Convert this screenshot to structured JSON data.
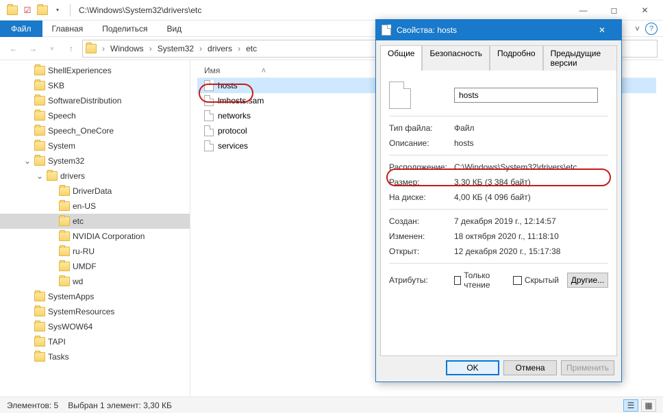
{
  "titlebar": {
    "path": "C:\\Windows\\System32\\drivers\\etc"
  },
  "ribbon": {
    "file": "Файл",
    "tabs": [
      "Главная",
      "Поделиться",
      "Вид"
    ]
  },
  "breadcrumb": [
    "Windows",
    "System32",
    "drivers",
    "etc"
  ],
  "tree": [
    {
      "label": "ShellExperiences",
      "depth": 1
    },
    {
      "label": "SKB",
      "depth": 1
    },
    {
      "label": "SoftwareDistribution",
      "depth": 1
    },
    {
      "label": "Speech",
      "depth": 1
    },
    {
      "label": "Speech_OneCore",
      "depth": 1
    },
    {
      "label": "System",
      "depth": 1
    },
    {
      "label": "System32",
      "depth": 1,
      "expanded": true
    },
    {
      "label": "drivers",
      "depth": 2,
      "expanded": true
    },
    {
      "label": "DriverData",
      "depth": 3
    },
    {
      "label": "en-US",
      "depth": 3
    },
    {
      "label": "etc",
      "depth": 3,
      "selected": true
    },
    {
      "label": "NVIDIA Corporation",
      "depth": 3
    },
    {
      "label": "ru-RU",
      "depth": 3
    },
    {
      "label": "UMDF",
      "depth": 3
    },
    {
      "label": "wd",
      "depth": 3
    },
    {
      "label": "SystemApps",
      "depth": 1
    },
    {
      "label": "SystemResources",
      "depth": 1
    },
    {
      "label": "SysWOW64",
      "depth": 1
    },
    {
      "label": "TAPI",
      "depth": 1
    },
    {
      "label": "Tasks",
      "depth": 1
    }
  ],
  "list": {
    "header_name": "Имя",
    "sort_indicator": "˄",
    "items": [
      "hosts",
      "lmhosts.sam",
      "networks",
      "protocol",
      "services"
    ],
    "selected": "hosts"
  },
  "status": {
    "count": "Элементов: 5",
    "selection": "Выбран 1 элемент: 3,30 КБ"
  },
  "dlg": {
    "title": "Свойства: hosts",
    "tabs": [
      "Общие",
      "Безопасность",
      "Подробно",
      "Предыдущие версии"
    ],
    "filename": "hosts",
    "rows": {
      "type_label": "Тип файла:",
      "type_val": "Файл",
      "desc_label": "Описание:",
      "desc_val": "hosts",
      "loc_label": "Расположение:",
      "loc_val": "C:\\Windows\\System32\\drivers\\etc",
      "size_label": "Размер:",
      "size_val": "3,30 КБ (3 384 байт)",
      "disk_label": "На диске:",
      "disk_val": "4,00 КБ (4 096 байт)",
      "created_label": "Создан:",
      "created_val": "7 декабря 2019 г., 12:14:57",
      "modified_label": "Изменен:",
      "modified_val": "18 октября 2020 г., 11:18:10",
      "opened_label": "Открыт:",
      "opened_val": "12 декабря 2020 г., 15:17:38",
      "attr_label": "Атрибуты:",
      "readonly": "Только чтение",
      "hidden": "Скрытый",
      "other": "Другие..."
    },
    "buttons": {
      "ok": "OK",
      "cancel": "Отмена",
      "apply": "Применить"
    }
  }
}
